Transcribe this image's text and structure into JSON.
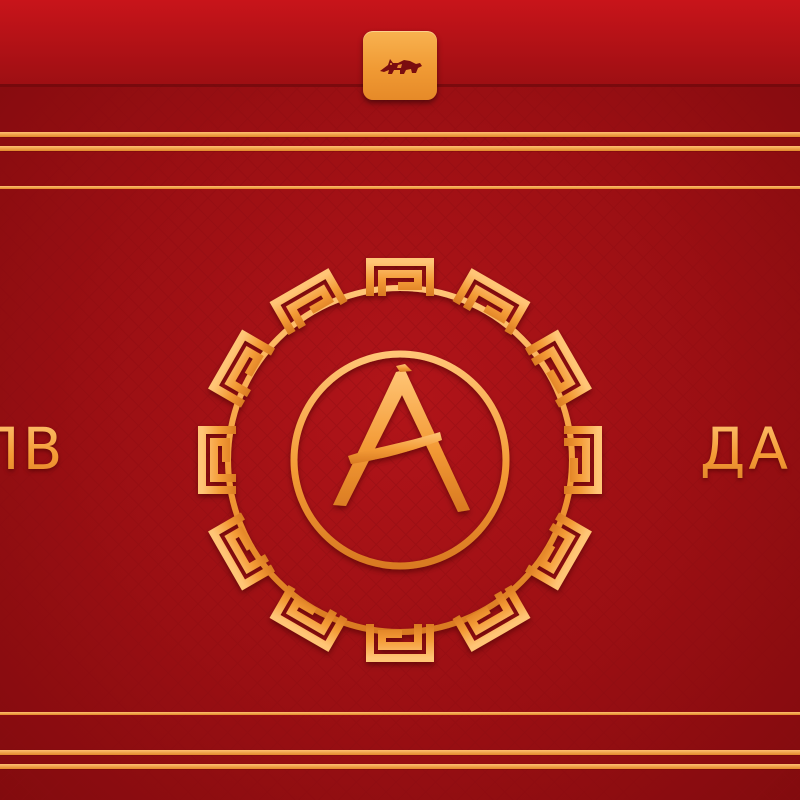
{
  "side_text": {
    "left": "ЛВ",
    "right": "ДА"
  },
  "icons": {
    "app_icon": "fox-icon",
    "emblem": "greek-key-emblem-icon",
    "emblem_letter": "letter-a-icon"
  },
  "colors": {
    "background": "#9b0f13",
    "background_light": "#b11419",
    "gold": "#f39a35",
    "gold_light": "#ffc576",
    "gold_dark": "#d97a22"
  }
}
